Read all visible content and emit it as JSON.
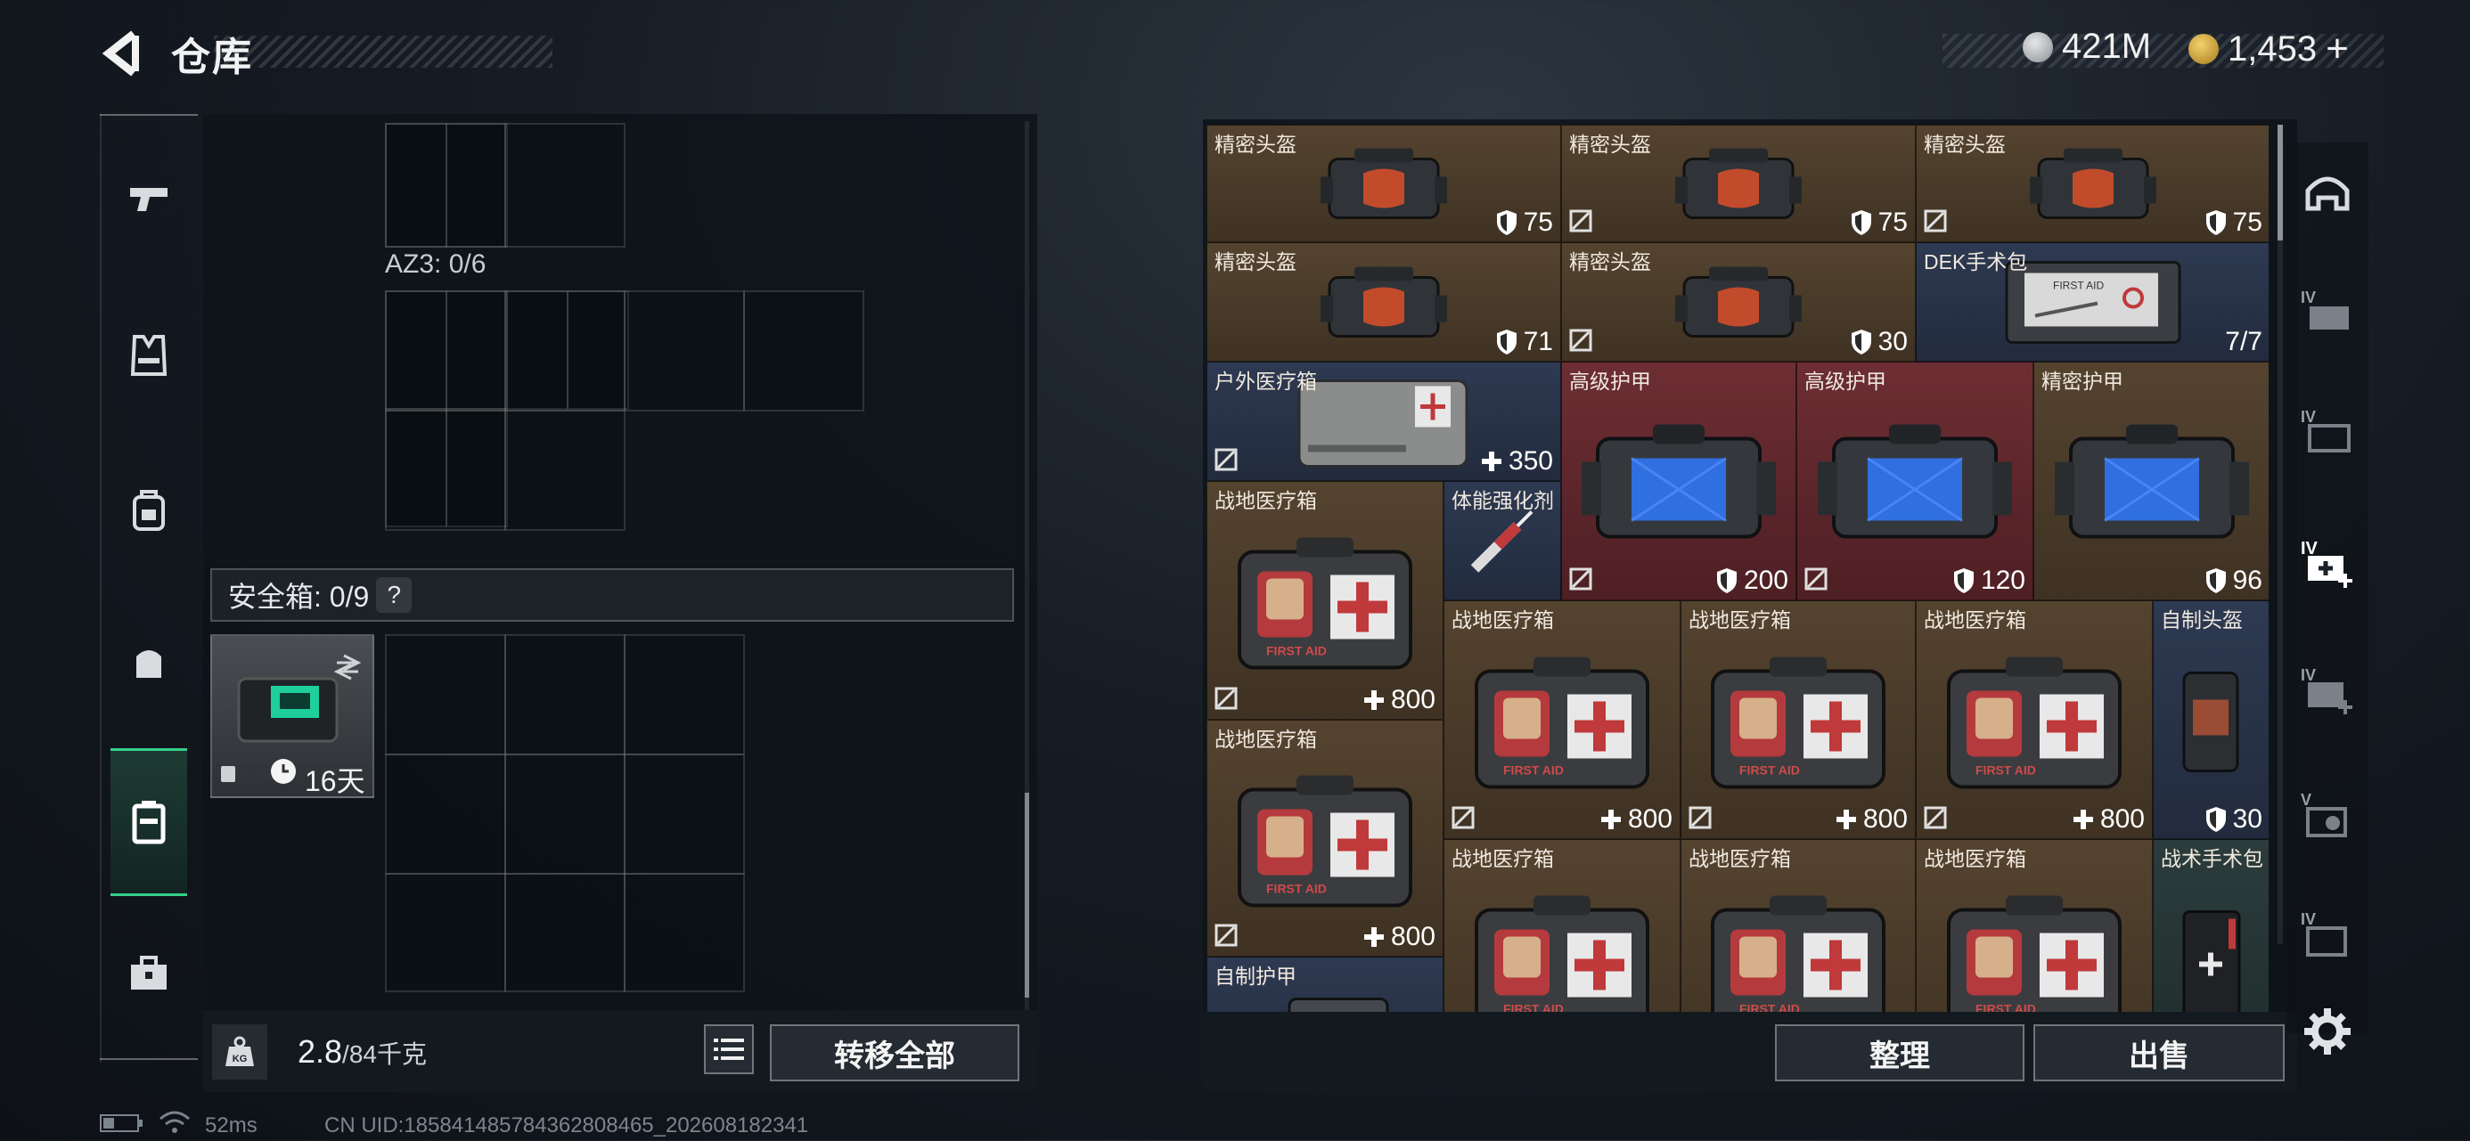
{
  "header": {
    "title": "仓库",
    "currency1": "421M",
    "currency2": "1,453",
    "add_label": "+"
  },
  "left": {
    "az3_label": "AZ3: 0/6",
    "safe_label": "安全箱: 0/9",
    "safe_help": "?",
    "case_time": "16天",
    "weight_current": "2.8",
    "weight_max": "/84千克",
    "transfer_label": "转移全部"
  },
  "stash": {
    "sort_label": "整理",
    "sell_label": "出售",
    "items": [
      {
        "name": "精密头盔",
        "value": "75",
        "icon": "shield",
        "no_insure": false
      },
      {
        "name": "精密头盔",
        "value": "75",
        "icon": "shield",
        "no_insure": true
      },
      {
        "name": "精密头盔",
        "value": "75",
        "icon": "shield",
        "no_insure": true
      },
      {
        "name": "精密头盔",
        "value": "71",
        "icon": "shield",
        "no_insure": false
      },
      {
        "name": "精密头盔",
        "value": "30",
        "icon": "shield",
        "no_insure": true
      },
      {
        "name": "DEK手术包",
        "value": "7/7",
        "icon": "none",
        "no_insure": false
      },
      {
        "name": "户外医疗箱",
        "value": "350",
        "icon": "plus",
        "no_insure": true
      },
      {
        "name": "高级护甲",
        "value": "200",
        "icon": "shield",
        "no_insure": true
      },
      {
        "name": "高级护甲",
        "value": "120",
        "icon": "shield",
        "no_insure": true
      },
      {
        "name": "精密护甲",
        "value": "96",
        "icon": "shield",
        "no_insure": false
      },
      {
        "name": "战地医疗箱",
        "value": "800",
        "icon": "plus",
        "no_insure": true
      },
      {
        "name": "体能强化剂",
        "value": "",
        "icon": "none",
        "no_insure": false
      },
      {
        "name": "战地医疗箱",
        "value": "800",
        "icon": "plus",
        "no_insure": true
      },
      {
        "name": "战地医疗箱",
        "value": "800",
        "icon": "plus",
        "no_insure": true
      },
      {
        "name": "战地医疗箱",
        "value": "800",
        "icon": "plus",
        "no_insure": true
      },
      {
        "name": "自制头盔",
        "value": "30",
        "icon": "shield",
        "no_insure": false
      },
      {
        "name": "战地医疗箱",
        "value": "800",
        "icon": "plus",
        "no_insure": true
      },
      {
        "name": "战地医疗箱",
        "value": "",
        "icon": "none",
        "no_insure": false
      },
      {
        "name": "战地医疗箱",
        "value": "",
        "icon": "none",
        "no_insure": false
      },
      {
        "name": "战地医疗箱",
        "value": "",
        "icon": "none",
        "no_insure": false
      },
      {
        "name": "战术手术包",
        "value": "",
        "icon": "none",
        "no_insure": false
      },
      {
        "name": "自制护甲",
        "value": "",
        "icon": "none",
        "no_insure": false
      }
    ]
  },
  "filters": [
    "IV",
    "IV",
    "IV",
    "IV",
    "V",
    "IV"
  ],
  "status": {
    "ping": "52ms",
    "uid": "CN UID:1858414857843628084​65_202608182341"
  },
  "colors": {
    "accent_green": "#33d08a",
    "cell_brown": "#54432f",
    "cell_blue": "#2e3a52",
    "cell_red": "#6d2e33"
  }
}
